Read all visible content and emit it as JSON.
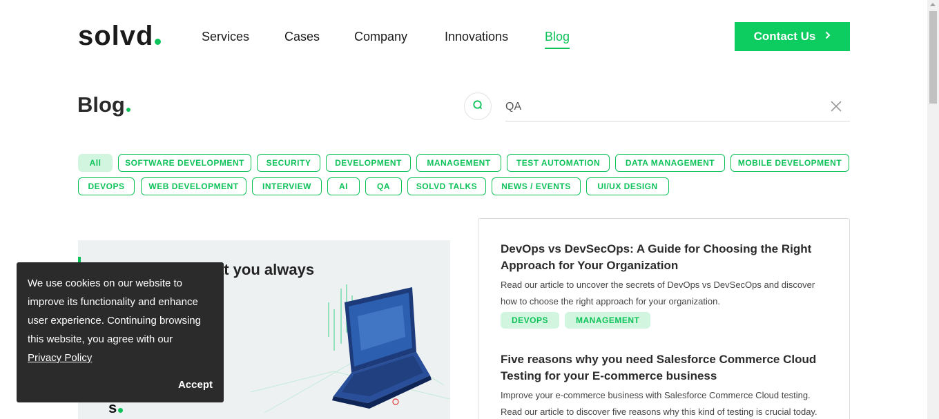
{
  "header": {
    "logo": "solvd",
    "nav": [
      "Services",
      "Cases",
      "Company",
      "Innovations",
      "Blog"
    ],
    "contact_label": "Contact Us"
  },
  "blog": {
    "title": "Blog",
    "search_value": "QA"
  },
  "tags": [
    "All",
    "SOFTWARE DEVELOPMENT",
    "SECURITY",
    "DEVELOPMENT",
    "MANAGEMENT",
    "TEST AUTOMATION",
    "DATA MANAGEMENT",
    "MOBILE DEVELOPMENT",
    "DEVOPS",
    "WEB DEVELOPMENT",
    "INTERVIEW",
    "AI",
    "QA",
    "SOLVD TALKS",
    "NEWS / EVENTS",
    "UI/UX DESIGN"
  ],
  "hero": {
    "partial_text": "at you always"
  },
  "cookie": {
    "text": "We use cookies on our website to improve its functionality and enhance user experience. Continuing browsing this website, you agree with our",
    "link": "Privacy Policy",
    "accept": "Accept"
  },
  "posts": [
    {
      "title": "DevOps vs DevSecOps: A Guide for Choosing the Right Approach for Your Organization",
      "desc": "Read our article to uncover the secrets of DevOps vs DevSecOps and discover how to choose the right approach for your organization.",
      "tags": [
        "DEVOPS",
        "MANAGEMENT"
      ]
    },
    {
      "title": "Five reasons why you need Salesforce Commerce Cloud Testing for your E-commerce business",
      "desc": "Improve your e-commerce business with Salesforce Commerce Cloud testing. Read our article to discover five reasons why this kind of testing is crucial today."
    }
  ],
  "colors": {
    "accent": "#0ec25a",
    "button": "#0dcc60",
    "tag_bg": "#d2f5df",
    "cookie_bg": "#2b2b2b"
  }
}
